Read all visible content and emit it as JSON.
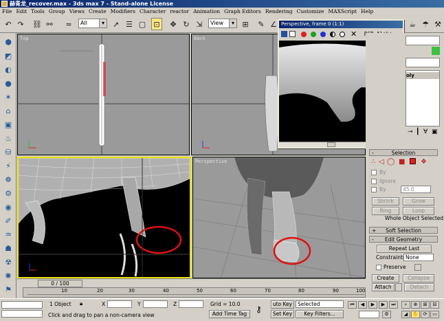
{
  "window": {
    "title": "赫青龙_recover.max - 3ds max 7 - Stand-alone License"
  },
  "menu": [
    "File",
    "Edit",
    "Tools",
    "Group",
    "Views",
    "Create",
    "Modifiers",
    "Character",
    "reactor",
    "Animation",
    "Graph Editors",
    "Rendering",
    "Customize",
    "MAXScript",
    "Help"
  ],
  "toolbar": {
    "selection_filter": "All",
    "reference_coord": "View"
  },
  "viewports": {
    "top": "Top",
    "back": "Back",
    "perspective": "Perspective"
  },
  "render_window": {
    "title": "Perspective, frame 0 (1:1)",
    "channel": "RGB Alpha"
  },
  "selection_rollout": {
    "header": "Selection",
    "by_vertex": "By",
    "ignore_backfacing": "Ignore",
    "by_angle": "By",
    "angle_value": "45.0",
    "shrink": "Shrink",
    "grow": "Grow",
    "ring": "Ring",
    "loop": "Loop",
    "status": "Whole Object Selected"
  },
  "soft_selection": {
    "header": "Soft Selection"
  },
  "edit_geometry": {
    "header": "Edit Geometry",
    "repeat_last": "Repeat Last",
    "constraints_label": "Constraints:",
    "constraints_value": "None",
    "preserve": "Preserve",
    "create": "Create",
    "collapse": "Collapse",
    "attach": "Attach",
    "detach": "Detach"
  },
  "modifier_panel": {
    "stack_item": "oly"
  },
  "timeline": {
    "slider": "0 / 100",
    "ticks": [
      "10",
      "20",
      "30",
      "40",
      "50",
      "60",
      "70",
      "80",
      "90",
      "100"
    ]
  },
  "status": {
    "selection": "1 Object",
    "x_label": "X",
    "y_label": "Y",
    "z_label": "Z",
    "grid": "Grid = 10.0",
    "auto_key": "uto Key",
    "set_key": "Set Key",
    "selected": "Selected",
    "key_filters": "Key Filters...",
    "prompt": "Click and drag to pan a non-camera view",
    "add_time_tag": "Add Time Tag"
  },
  "colors": {
    "title_bar": "#0a246a",
    "active_viewport": "#e8e000",
    "annotation": "#e01010"
  }
}
